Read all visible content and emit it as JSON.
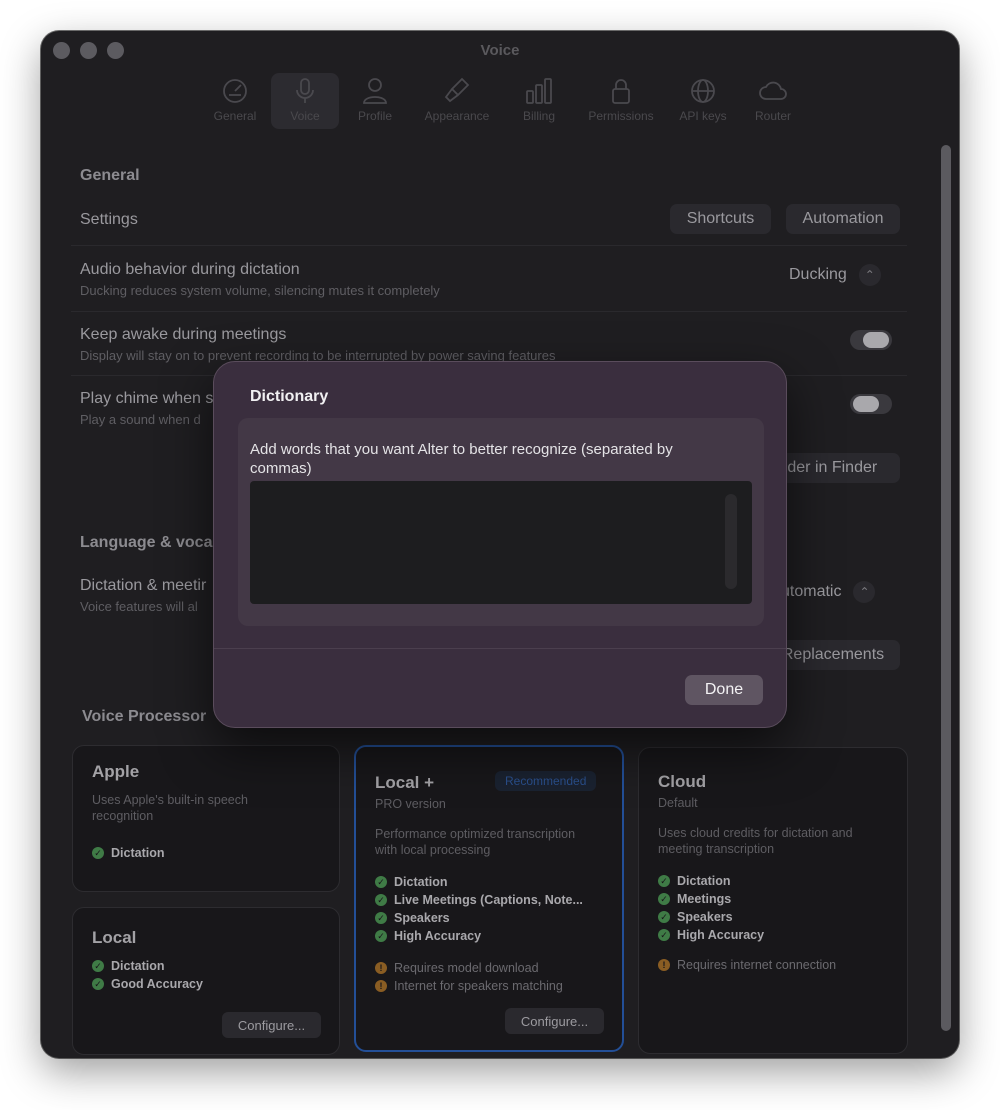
{
  "window": {
    "title": "Voice"
  },
  "toolbar": {
    "items": [
      {
        "label": "General",
        "icon": "gauge-icon"
      },
      {
        "label": "Voice",
        "icon": "microphone-icon"
      },
      {
        "label": "Profile",
        "icon": "person-icon"
      },
      {
        "label": "Appearance",
        "icon": "paintbrush-icon"
      },
      {
        "label": "Billing",
        "icon": "bars-icon"
      },
      {
        "label": "Permissions",
        "icon": "lock-icon"
      },
      {
        "label": "API keys",
        "icon": "globe-icon"
      },
      {
        "label": "Router",
        "icon": "cloud-icon"
      }
    ],
    "active": "Voice"
  },
  "general": {
    "heading": "General",
    "settings_label": "Settings",
    "shortcuts_btn": "Shortcuts",
    "automation_btn": "Automation",
    "audio_title": "Audio behavior during dictation",
    "audio_sub": "Ducking reduces system volume, silencing mutes it completely",
    "audio_value": "Ducking",
    "awake_title": "Keep awake during meetings",
    "awake_sub": "Display will stay on to prevent recording to be interrupted by power saving features",
    "chime_title": "Play chime when s",
    "chime_sub": "Play a sound when d",
    "finder_btn": "lder in Finder"
  },
  "language": {
    "heading": "Language & voca",
    "dictation_title": "Dictation & meetir",
    "dictation_sub": "Voice features will al",
    "dictation_value": "utomatic",
    "replacements_btn": "Replacements"
  },
  "processor": {
    "heading": "Voice Processor",
    "apple": {
      "title": "Apple",
      "desc": "Uses Apple's built-in speech recognition",
      "features": [
        "Dictation"
      ]
    },
    "local": {
      "title": "Local",
      "features": [
        "Dictation",
        "Good Accuracy"
      ],
      "configure": "Configure..."
    },
    "local_plus": {
      "title": "Local +",
      "badge": "Recommended",
      "sub": "PRO version",
      "desc": "Performance optimized transcription with local processing",
      "features": [
        "Dictation",
        "Live Meetings (Captions, Note...",
        "Speakers",
        "High Accuracy"
      ],
      "warnings": [
        "Requires model download",
        "Internet for speakers matching"
      ],
      "configure": "Configure..."
    },
    "cloud": {
      "title": "Cloud",
      "sub": "Default",
      "desc": "Uses cloud credits for dictation and meeting transcription",
      "features": [
        "Dictation",
        "Meetings",
        "Speakers",
        "High Accuracy"
      ],
      "warnings": [
        "Requires internet connection"
      ]
    }
  },
  "dialog": {
    "title": "Dictionary",
    "label": "Add words that you want Alter to better recognize (separated by commas)",
    "input_value": "",
    "done": "Done"
  }
}
